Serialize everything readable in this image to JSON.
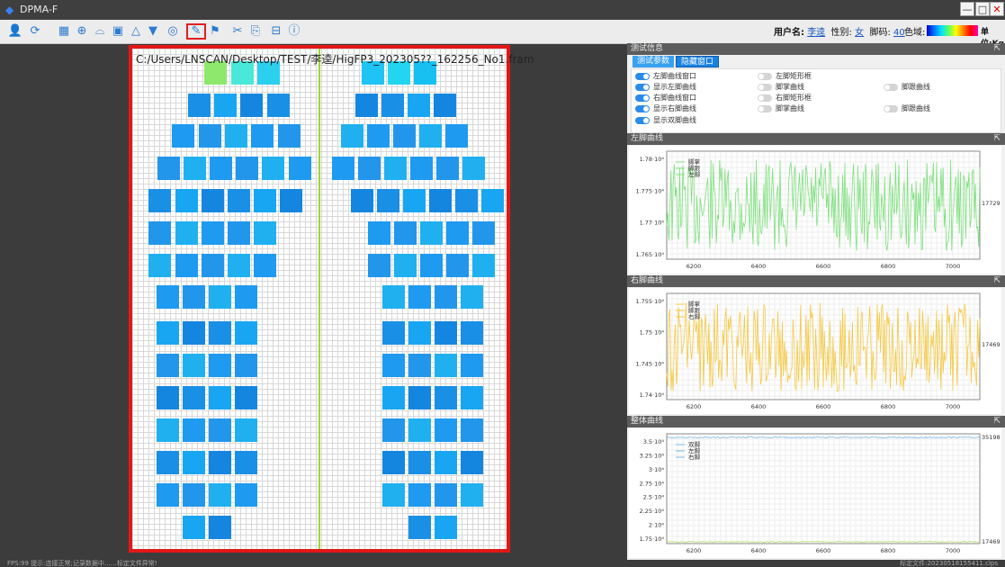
{
  "window": {
    "title": "DPMA-F",
    "minimize": "—",
    "maximize": "□",
    "close": "✕"
  },
  "toolbar": {
    "icons": [
      "user-icon",
      "refresh-icon",
      "grid-icon",
      "crosshair-icon",
      "cylinder-icon",
      "image-icon",
      "triangle-icon",
      "filter-icon",
      "target-icon",
      "edit-icon",
      "flag-icon",
      "tools-icon",
      "export-icon",
      "link-icon",
      "info-icon"
    ],
    "user_label": "用户名:",
    "user_name": "李逵",
    "gender_label": "性别:",
    "gender_value": "女",
    "foot_label": "脚码:",
    "foot_value": "40",
    "color_label": "色域:",
    "unit_label": "单位:Kg"
  },
  "canvas": {
    "file_path": "C:/Users/LNSCAN/Desktop/TEST/李逵/HigFP3_202305??_162256_No1.fram"
  },
  "panel": {
    "header": "测试信息",
    "tabs": [
      "测试参数",
      "隐藏窗口"
    ],
    "options": [
      {
        "label": "左脚曲线窗口",
        "on": true
      },
      {
        "label": "左脚矩形框",
        "on": false
      },
      {
        "label": "显示左脚曲线",
        "on": true
      },
      {
        "label": "脚掌曲线",
        "on": false
      },
      {
        "label": "脚跟曲线",
        "on": false
      },
      {
        "label": "右脚曲线窗口",
        "on": true
      },
      {
        "label": "右脚矩形框",
        "on": false
      },
      {
        "label": "显示右脚曲线",
        "on": true
      },
      {
        "label": "脚掌曲线",
        "on": false
      },
      {
        "label": "脚跟曲线",
        "on": false
      },
      {
        "label": "显示双脚曲线",
        "on": true
      }
    ]
  },
  "charts": [
    {
      "header": "左脚曲线",
      "legend": [
        "脚掌",
        "脚跟",
        "左脚"
      ],
      "ylabels": [
        "1.78·10⁴",
        "1.775·10⁴",
        "1.77·10⁴",
        "1.765·10⁴"
      ],
      "xlabels": [
        "6200",
        "6400",
        "6600",
        "6800",
        "7000"
      ],
      "right_label": "17729",
      "color": "#7de07d"
    },
    {
      "header": "右脚曲线",
      "legend": [
        "脚掌",
        "脚跟",
        "右脚"
      ],
      "ylabels": [
        "1.755·10⁴",
        "1.75·10⁴",
        "1.745·10⁴",
        "1.74·10⁴"
      ],
      "xlabels": [
        "6200",
        "6400",
        "6600",
        "6800",
        "7000"
      ],
      "right_label": "17469",
      "color": "#f5c842"
    },
    {
      "header": "整体曲线",
      "legend": [
        "双脚",
        "左脚",
        "右脚"
      ],
      "ylabels": [
        "3.5·10⁴",
        "3.25·10⁴",
        "3·10⁴",
        "2.75·10⁴",
        "2.5·10⁴",
        "2.25·10⁴",
        "2·10⁴",
        "1.75·10⁴"
      ],
      "xlabels": [
        "6200",
        "6400",
        "6600",
        "6800",
        "7000"
      ],
      "right_label": "35198",
      "right_label_low": "17469",
      "color": "#7ab8e8"
    }
  ],
  "status": {
    "left": "FPS:99   提示:连接正常;记录数据中……标定文件异常!",
    "right": "标定文件:20230518155411.clps"
  },
  "colors": {
    "accent": "#2b8be8",
    "frame": "#e21818",
    "divider": "#9dd832"
  }
}
